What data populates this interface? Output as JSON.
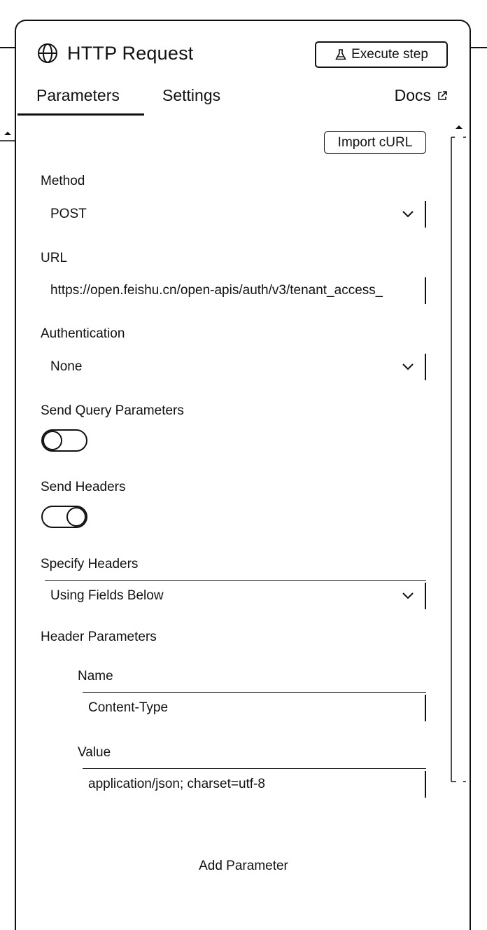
{
  "header": {
    "title": "HTTP Request",
    "execute_label": "Execute step"
  },
  "tabs": [
    {
      "label": "Parameters",
      "active": true
    },
    {
      "label": "Settings",
      "active": false
    }
  ],
  "docs_label": "Docs",
  "import_curl_label": "Import cURL",
  "fields": {
    "method": {
      "label": "Method",
      "value": "POST"
    },
    "url": {
      "label": "URL",
      "value": "https://open.feishu.cn/open-apis/auth/v3/tenant_access_"
    },
    "authentication": {
      "label": "Authentication",
      "value": "None"
    },
    "send_query": {
      "label": "Send Query Parameters",
      "enabled": false
    },
    "send_headers": {
      "label": "Send Headers",
      "enabled": true
    },
    "specify_headers": {
      "label": "Specify Headers",
      "value": "Using Fields Below"
    },
    "header_parameters": {
      "label": "Header Parameters",
      "items": [
        {
          "name_label": "Name",
          "name_value": "Content-Type",
          "value_label": "Value",
          "value_value": "application/json; charset=utf-8"
        }
      ]
    }
  },
  "add_parameter_label": "Add Parameter",
  "icons": [
    "globe-icon",
    "flask-icon",
    "external-link-icon",
    "chevron-down-icon"
  ]
}
